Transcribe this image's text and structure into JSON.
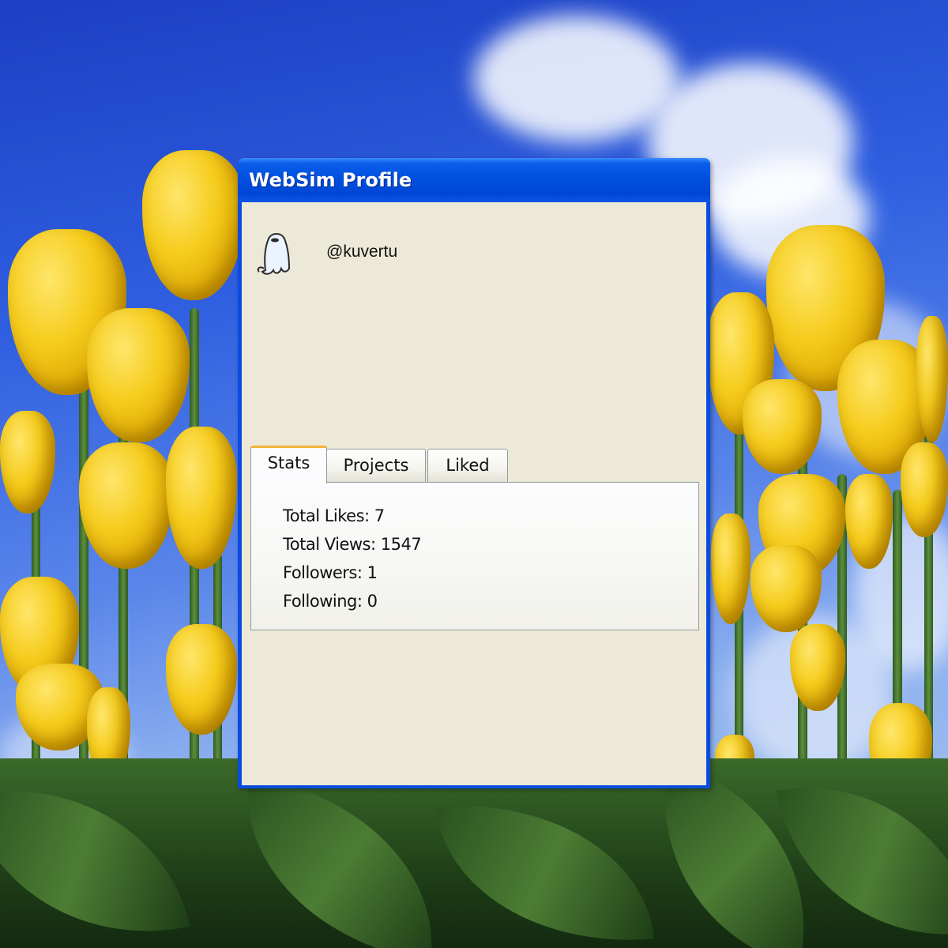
{
  "window": {
    "title": "WebSim Profile"
  },
  "profile": {
    "username": "@kuvertu",
    "avatar_icon": "ghost-avatar-icon"
  },
  "tabs": [
    {
      "label": "Stats",
      "active": true
    },
    {
      "label": "Projects",
      "active": false
    },
    {
      "label": "Liked",
      "active": false
    }
  ],
  "stats": {
    "total_likes": "Total Likes: 7",
    "total_views": "Total Views: 1547",
    "followers": "Followers: 1",
    "following": "Following: 0"
  },
  "colors": {
    "titlebar": "#0050e0",
    "client_bg": "#ece9d8",
    "active_tab_accent": "#f0b33c"
  }
}
